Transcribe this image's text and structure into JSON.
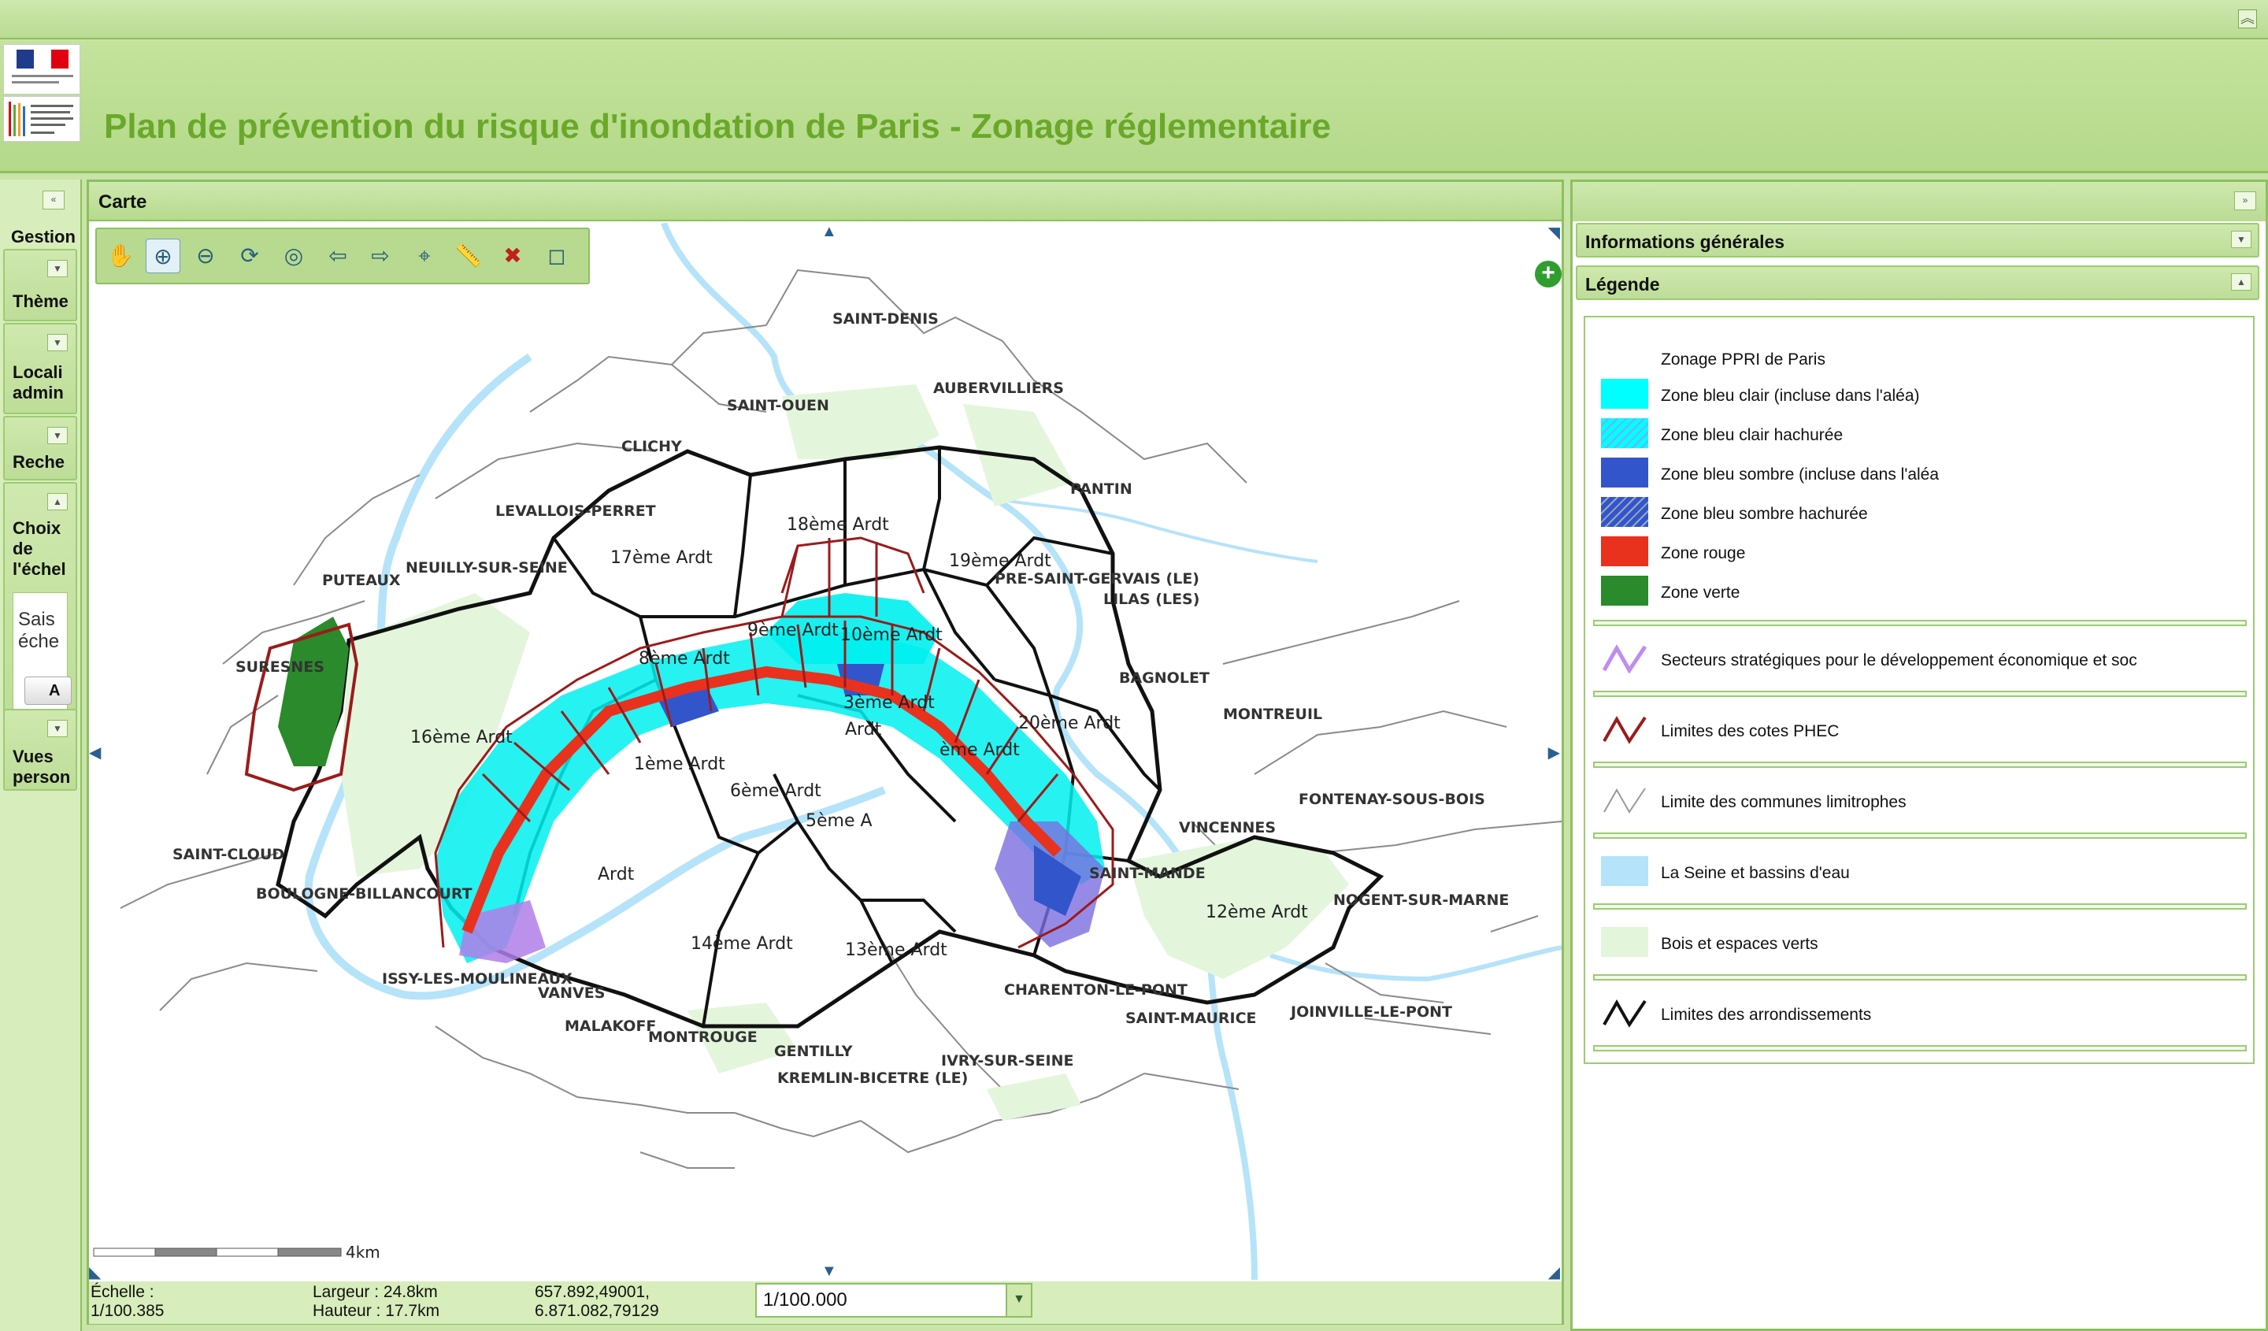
{
  "app": {
    "title": "Plan de prévention du risque d'inondation de Paris - Zonage réglementaire",
    "collapse_icon": "double-chevron-up-icon"
  },
  "left_panel": {
    "toggle_icon": "double-chevron-left-icon",
    "sections": [
      {
        "label": "Gestion",
        "state": "header"
      },
      {
        "label": "Thème",
        "state": "collapsed"
      },
      {
        "label": "Locali\nadmin",
        "state": "collapsed"
      },
      {
        "label": "Reche",
        "state": "collapsed"
      },
      {
        "label": "Choix\nde\nl'échel",
        "state": "expanded"
      },
      {
        "label": "Vues\nperson",
        "state": "collapsed"
      }
    ],
    "scale_input_placeholder": "Sais\néche",
    "scale_button_label": "A"
  },
  "map": {
    "header": "Carte",
    "tools": [
      "pan-hand-icon",
      "zoom-in-icon",
      "zoom-out-icon",
      "refresh-icon",
      "zoom-extent-icon",
      "previous-view-icon",
      "next-view-icon",
      "locate-xy-icon",
      "measure-icon",
      "clear-icon",
      "fullscreen-icon"
    ],
    "active_tool": "zoom-in-icon",
    "scalebar_label": "4km",
    "labels": {
      "communes": [
        "SAINT-DENIS",
        "AUBERVILLIERS",
        "SAINT-OUEN",
        "CLICHY",
        "PANTIN",
        "LEVALLOIS-PERRET",
        "PUTEAUX",
        "NEUILLY-SUR-SEINE",
        "PRE-SAINT-GERVAIS (LE)",
        "LILAS (LES)",
        "SURESNES",
        "BAGNOLET",
        "MONTREUIL",
        "FONTENAY-SOUS-BOIS",
        "VINCENNES",
        "SAINT-MANDE",
        "SAINT-CLOUD",
        "BOULOGNE-BILLANCOURT",
        "NOGENT-SUR-MARNE",
        "ISSY-LES-MOULINEAUX",
        "VANVES",
        "MALAKOFF",
        "MONTROUGE",
        "GENTILLY",
        "KREMLIN-BICETRE (LE)",
        "IVRY-SUR-SEINE",
        "CHARENTON-LE-PONT",
        "SAINT-MAURICE",
        "JOINVILLE-LE-PONT"
      ],
      "arrondissements": [
        "18ème Ardt",
        "17ème Ardt",
        "19ème Ardt",
        "10ème Ardt",
        "8ème Ardt",
        "9ème Ardt",
        "16ème Ardt",
        "20ème Ardt",
        "1ème Ardt",
        "3ème Ardt",
        "6ème Ardt",
        "5ème A",
        "ème Ardt",
        "Ardt",
        "14ème Ardt",
        "13ème Ardt",
        "12ème Ardt",
        "Ardt"
      ]
    }
  },
  "status": {
    "echelle_label": "Échelle :",
    "echelle_value": "1/100.385",
    "largeur": "Largeur : 24.8km",
    "hauteur": "Hauteur : 17.7km",
    "coord1": "657.892,49001,",
    "coord2": "6.871.082,79129",
    "scale_select": "1/100.000"
  },
  "right_panel": {
    "toggle_icon": "double-chevron-right-icon",
    "info_title": "Informations générales",
    "legend_title": "Légende",
    "legend_group_title": "Zonage PPRI de Paris",
    "legend_items": [
      {
        "label": "Zone bleu clair (incluse dans l'aléa)",
        "color": "#00ffff",
        "pattern": "solid"
      },
      {
        "label": "Zone bleu clair hachurée",
        "color": "#00ffff",
        "pattern": "hatch"
      },
      {
        "label": "Zone bleu sombre (incluse dans l'aléa",
        "color": "#3355cc",
        "pattern": "solid"
      },
      {
        "label": "Zone bleu sombre hachurée",
        "color": "#3355cc",
        "pattern": "hatch"
      },
      {
        "label": "Zone rouge",
        "color": "#e8321e",
        "pattern": "solid"
      },
      {
        "label": "Zone verte",
        "color": "#2b8a2b",
        "pattern": "solid"
      }
    ],
    "legend_lines": [
      {
        "label": "Secteurs stratégiques pour le développement économique et soc",
        "color": "#c08cf0",
        "kind": "line"
      },
      {
        "label": "Limites des cotes PHEC",
        "color": "#9b1b1b",
        "kind": "line"
      },
      {
        "label": "Limite des communes limitrophes",
        "color": "#999999",
        "kind": "line"
      },
      {
        "label": "La Seine et bassins d'eau",
        "color": "#b5e3fa",
        "kind": "fill"
      },
      {
        "label": "Bois et espaces verts",
        "color": "#e3f6dc",
        "kind": "fill"
      },
      {
        "label": "Limites des arrondissements",
        "color": "#111111",
        "kind": "line"
      }
    ]
  },
  "colors": {
    "accent": "#6aa82a",
    "panel": "#c9e3a8",
    "border": "#8cc060"
  }
}
